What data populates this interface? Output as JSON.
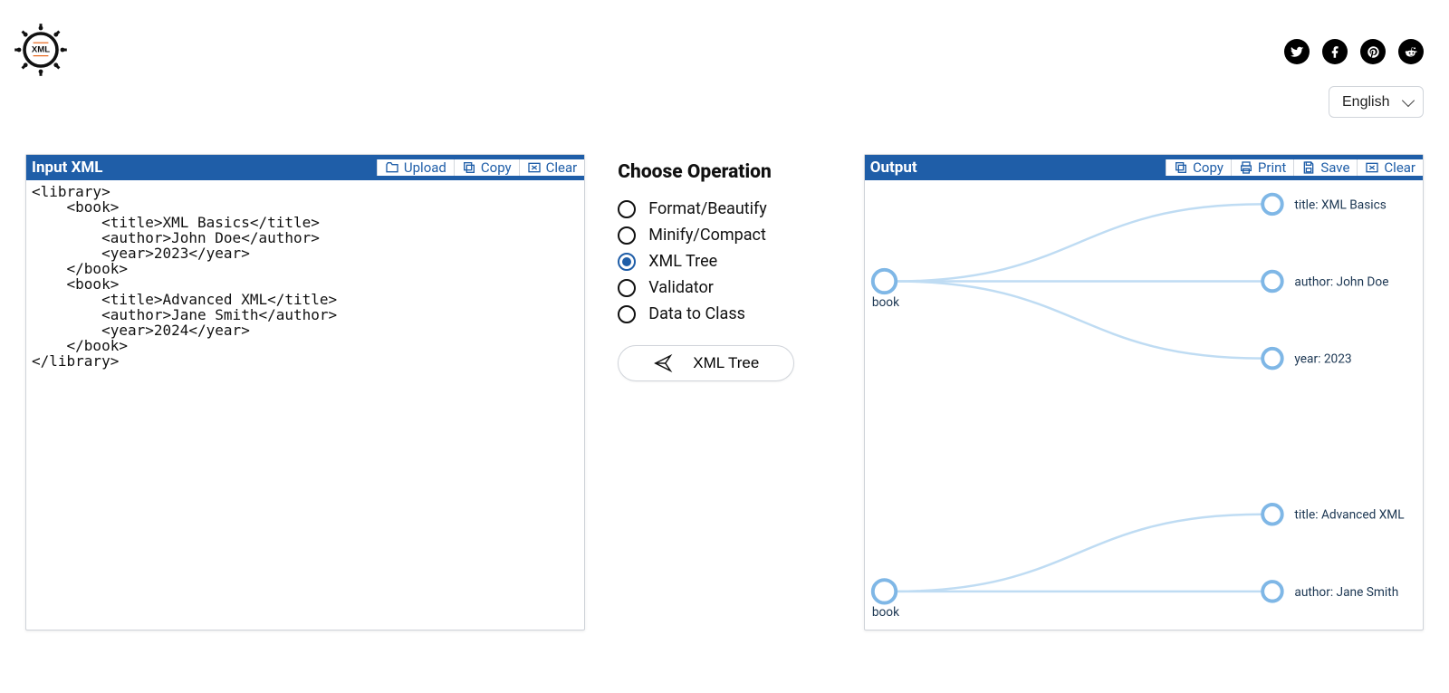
{
  "header": {
    "language": "English",
    "social": [
      "twitter",
      "facebook",
      "pinterest",
      "reddit"
    ]
  },
  "input": {
    "title": "Input XML",
    "tools": {
      "upload": "Upload",
      "copy": "Copy",
      "clear": "Clear"
    },
    "code": "<library>\n    <book>\n        <title>XML Basics</title>\n        <author>John Doe</author>\n        <year>2023</year>\n    </book>\n    <book>\n        <title>Advanced XML</title>\n        <author>Jane Smith</author>\n        <year>2024</year>\n    </book>\n</library>"
  },
  "operations": {
    "heading": "Choose Operation",
    "items": [
      {
        "id": "format",
        "label": "Format/Beautify",
        "selected": false
      },
      {
        "id": "minify",
        "label": "Minify/Compact",
        "selected": false
      },
      {
        "id": "tree",
        "label": "XML Tree",
        "selected": true
      },
      {
        "id": "validator",
        "label": "Validator",
        "selected": false
      },
      {
        "id": "dataclass",
        "label": "Data to Class",
        "selected": false
      }
    ],
    "run_label": "XML Tree"
  },
  "output": {
    "title": "Output",
    "tools": {
      "copy": "Copy",
      "print": "Print",
      "save": "Save",
      "clear": "Clear"
    },
    "tree": {
      "groups": [
        {
          "name": "book",
          "children": [
            {
              "label": "title: XML Basics"
            },
            {
              "label": "author: John Doe"
            },
            {
              "label": "year: 2023"
            }
          ]
        },
        {
          "name": "book",
          "children": [
            {
              "label": "title: Advanced XML"
            },
            {
              "label": "author: Jane Smith"
            }
          ]
        }
      ]
    }
  }
}
